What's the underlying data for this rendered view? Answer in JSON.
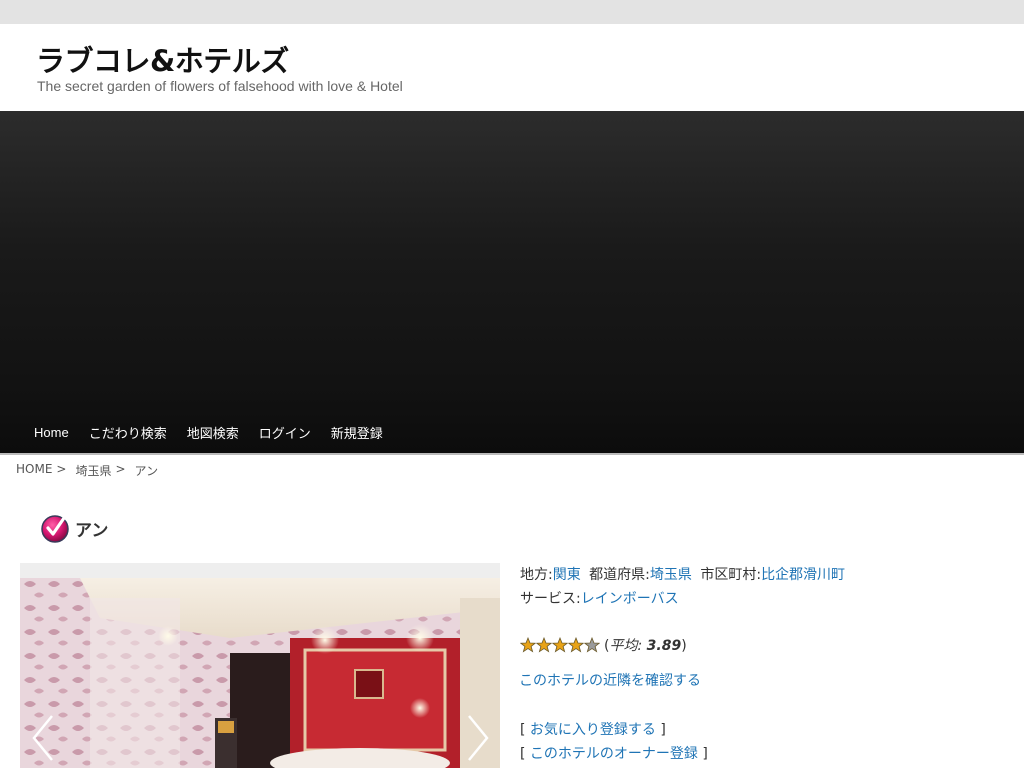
{
  "site": {
    "title": "ラブコレ&ホテルズ",
    "description": "The secret garden of flowers of falsehood with love & Hotel"
  },
  "nav": {
    "items": [
      {
        "label": "Home"
      },
      {
        "label": "こだわり検索"
      },
      {
        "label": "地図検索"
      },
      {
        "label": "ログイン"
      },
      {
        "label": "新規登録"
      }
    ]
  },
  "breadcrumb": {
    "home": "HOME",
    "prefecture": "埼玉県",
    "current": "アン",
    "separator": ">"
  },
  "page": {
    "title": "アン",
    "icon": "checkmark-circle-icon"
  },
  "info": {
    "region_label": "地方:",
    "region_value": "関東",
    "prefecture_label": "都道府県:",
    "prefecture_value": "埼玉県",
    "city_label": "市区町村:",
    "city_value": "比企郡滑川町",
    "service_label": "サービス:",
    "service_value": "レインボーバス"
  },
  "rating": {
    "value": 3.89,
    "max": 5,
    "open": "(",
    "avg_label": "平均: ",
    "avg_value": "3.89",
    "close": ")"
  },
  "links": {
    "nearby": "このホテルの近隣を確認する",
    "favorite": "お気に入り登録する",
    "owner": "このホテルのオーナー登録",
    "bracket_open": "[",
    "bracket_close": "]"
  },
  "colors": {
    "link": "#1f74b5",
    "nav_bg": "#151515",
    "star_fill": "#e8a317"
  }
}
